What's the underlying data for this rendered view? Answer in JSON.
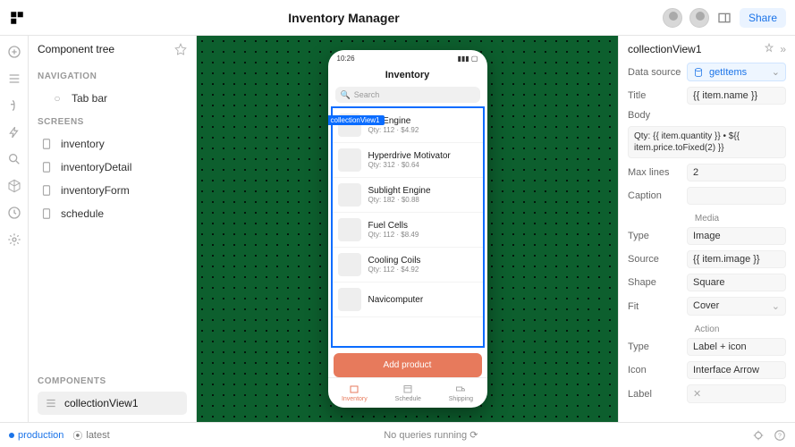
{
  "topbar": {
    "title": "Inventory Manager",
    "share_label": "Share"
  },
  "ctree": {
    "header": "Component tree",
    "nav_label": "NAVIGATION",
    "nav_item": "Tab bar",
    "screens_label": "SCREENS",
    "screens": [
      "inventory",
      "inventoryDetail",
      "inventoryForm",
      "schedule"
    ],
    "components_label": "COMPONENTS",
    "component_item": "collectionView1"
  },
  "phone": {
    "time": "10:26",
    "title": "Inventory",
    "search_placeholder": "Search",
    "tag": "collectionView1",
    "items": [
      {
        "name": "Ion Engine",
        "sub": "Qty: 112 · $4.92"
      },
      {
        "name": "Hyperdrive Motivator",
        "sub": "Qty: 312 · $0.64"
      },
      {
        "name": "Sublight Engine",
        "sub": "Qty: 182 · $0.88"
      },
      {
        "name": "Fuel Cells",
        "sub": "Qty: 112 · $8.49"
      },
      {
        "name": "Cooling Coils",
        "sub": "Qty: 112 · $4.92"
      },
      {
        "name": "Navicomputer",
        "sub": ""
      }
    ],
    "add_label": "Add product",
    "tabs": [
      "Inventory",
      "Schedule",
      "Shipping"
    ]
  },
  "props": {
    "header": "collectionView1",
    "datasource_label": "Data source",
    "datasource_value": "getItems",
    "title_label": "Title",
    "title_value": "{{ item.name }}",
    "body_label": "Body",
    "body_value": "Qty: {{ item.quantity }} • ${{ item.price.toFixed(2) }}",
    "maxlines_label": "Max lines",
    "maxlines_value": "2",
    "caption_label": "Caption",
    "media_label": "Media",
    "type_label": "Type",
    "type_value": "Image",
    "source_label": "Source",
    "source_value": "{{ item.image }}",
    "shape_label": "Shape",
    "shape_value": "Square",
    "fit_label": "Fit",
    "fit_value": "Cover",
    "action_label": "Action",
    "atype_label": "Type",
    "atype_value": "Label + icon",
    "icon_label": "Icon",
    "icon_value": "Interface Arrow",
    "label_label": "Label"
  },
  "status": {
    "env": "production",
    "ver": "latest",
    "mid": "No queries running"
  }
}
